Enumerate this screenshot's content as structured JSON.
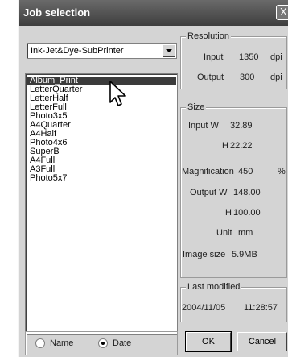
{
  "window": {
    "title": "Job selection",
    "close_glyph": "X"
  },
  "printer_select": {
    "value": "Ink-Jet&Dye-SubPrinter"
  },
  "jobs": {
    "items": [
      "Album_Print",
      "LetterQuarter",
      "LetterHalf",
      "LetterFull",
      "Photo3x5",
      "A4Quarter",
      "A4Half",
      "Photo4x6",
      "SuperB",
      "A4Full",
      "A3Full",
      "Photo5x7"
    ],
    "selected": "Album_Print"
  },
  "resolution": {
    "legend": "Resolution",
    "input_label": "Input",
    "input_value": "1350",
    "input_unit": "dpi",
    "output_label": "Output",
    "output_value": "300",
    "output_unit": "dpi"
  },
  "size": {
    "legend": "Size",
    "input_w_label": "Input W",
    "input_w_value": "32.89",
    "input_h_label": "H",
    "input_h_value": "22.22",
    "magnification_label": "Magnification",
    "magnification_value": "450",
    "magnification_unit": "%",
    "output_w_label": "Output W",
    "output_w_value": "148.00",
    "output_h_label": "H",
    "output_h_value": "100.00",
    "unit_label": "Unit",
    "unit_value": "mm",
    "image_size_label": "Image size",
    "image_size_value": "5.9MB"
  },
  "last_modified": {
    "legend": "Last modified",
    "date": "2004/11/05",
    "time": "11:28:57"
  },
  "sort": {
    "name_label": "Name",
    "date_label": "Date",
    "selected": "Date"
  },
  "buttons": {
    "ok": "OK",
    "cancel": "Cancel"
  }
}
